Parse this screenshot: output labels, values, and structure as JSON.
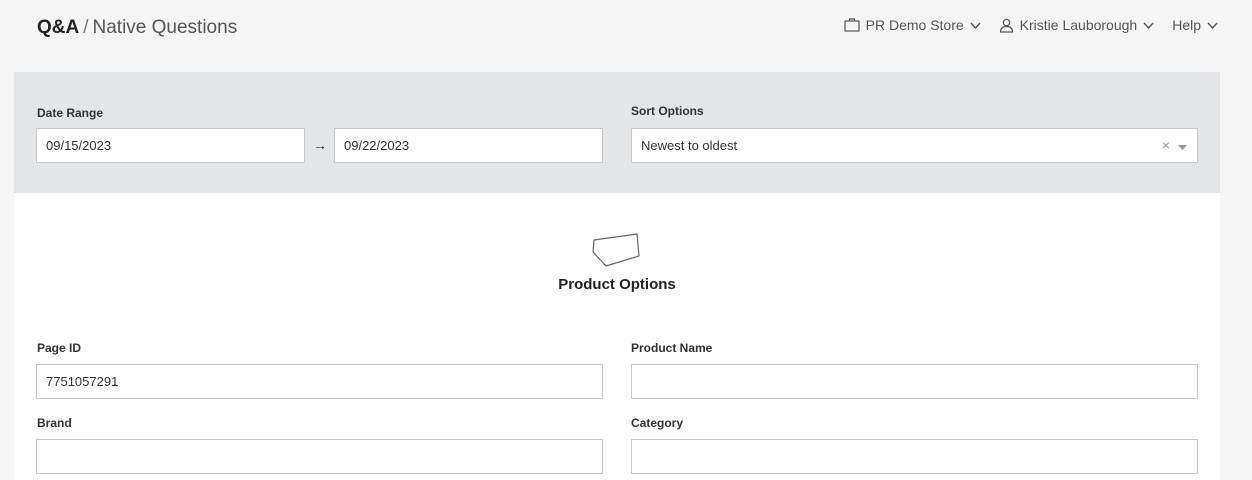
{
  "header": {
    "title_strong": "Q&A",
    "title_separator": "/",
    "title_sub": "Native Questions",
    "nav": {
      "store_label": "PR Demo Store",
      "user_label": "Kristie Lauborough",
      "help_label": "Help"
    }
  },
  "filters": {
    "date_range_label": "Date Range",
    "date_from": "09/15/2023",
    "date_arrow": "→",
    "date_to": "09/22/2023",
    "sort_label": "Sort Options",
    "sort_value": "Newest to oldest",
    "sort_clear": "×"
  },
  "product_options": {
    "title": "Product Options",
    "icon": "tag-icon",
    "page_id_label": "Page ID",
    "page_id_value": "7751057291",
    "product_name_label": "Product Name",
    "product_name_value": "",
    "brand_label": "Brand",
    "brand_value": "",
    "category_label": "Category",
    "category_value": ""
  },
  "colors": {
    "page_bg": "#f5f5f5",
    "panel_bg": "#e4e5e7",
    "card_bg": "#ffffff",
    "input_border": "#c9c9c9"
  }
}
